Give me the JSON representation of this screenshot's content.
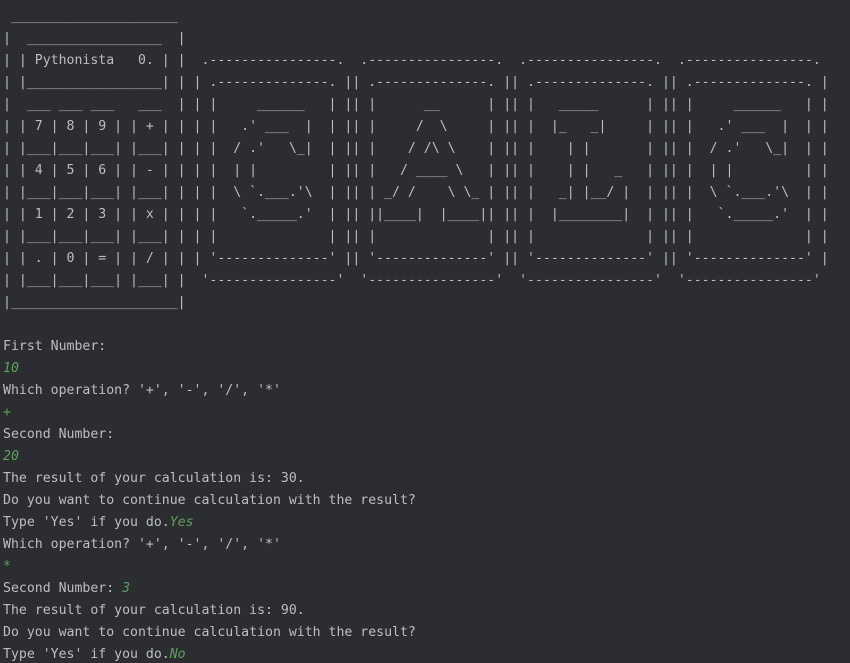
{
  "banner": " _____________________\n|  _________________  |\n| | Pythonista   0. | |  .----------------.  .----------------.  .----------------.  .----------------.\n| |_________________| | | .--------------. || .--------------. || .--------------. || .--------------. |\n|  ___ ___ ___   ___  | | |     ______   | || |      __      | || |   _____      | || |     ______   | |\n| | 7 | 8 | 9 | | + | | | |   .' ___  |  | || |     /  \\     | || |  |_   _|     | || |   .' ___  |  | |\n| |___|___|___| |___| | | |  / .'   \\_|  | || |    / /\\ \\    | || |    | |       | || |  / .'   \\_|  | |\n| | 4 | 5 | 6 | | - | | | |  | |         | || |   / ____ \\   | || |    | |   _   | || |  | |         | |\n| |___|___|___| |___| | | |  \\ `.___.'\\  | || | _/ /    \\ \\_ | || |   _| |__/ |  | || |  \\ `.___.'\\  | |\n| | 1 | 2 | 3 | | x | | | |   `._____.'  | || ||____|  |____|| || |  |________|  | || |   `._____.'  | |\n| |___|___|___| |___| | | |              | || |              | || |              | || |              | |\n| | . | 0 | = | | / | | | '--------------' || '--------------' || '--------------' || '--------------' |\n| |___|___|___| |___| |  '----------------'  '----------------'  '----------------'  '----------------'\n|_____________________|",
  "lines": [
    {
      "text": "First Number:",
      "input": ""
    },
    {
      "text": "",
      "input": "10"
    },
    {
      "text": "Which operation? '+', '-', '/', '*'",
      "input": ""
    },
    {
      "text": "",
      "input": "+"
    },
    {
      "text": "Second Number:",
      "input": ""
    },
    {
      "text": "",
      "input": "20"
    },
    {
      "text": "The result of your calculation is: 30.",
      "input": ""
    },
    {
      "text": "Do you want to continue calculation with the result?",
      "input": ""
    },
    {
      "text": "Type 'Yes' if you do.",
      "input": "Yes"
    },
    {
      "text": "Which operation? '+', '-', '/', '*'",
      "input": ""
    },
    {
      "text": "",
      "input": "*"
    },
    {
      "text": "Second Number: ",
      "input": "3"
    },
    {
      "text": "The result of your calculation is: 90.",
      "input": ""
    },
    {
      "text": "Do you want to continue calculation with the result?",
      "input": ""
    },
    {
      "text": "Type 'Yes' if you do.",
      "input": "No"
    }
  ]
}
